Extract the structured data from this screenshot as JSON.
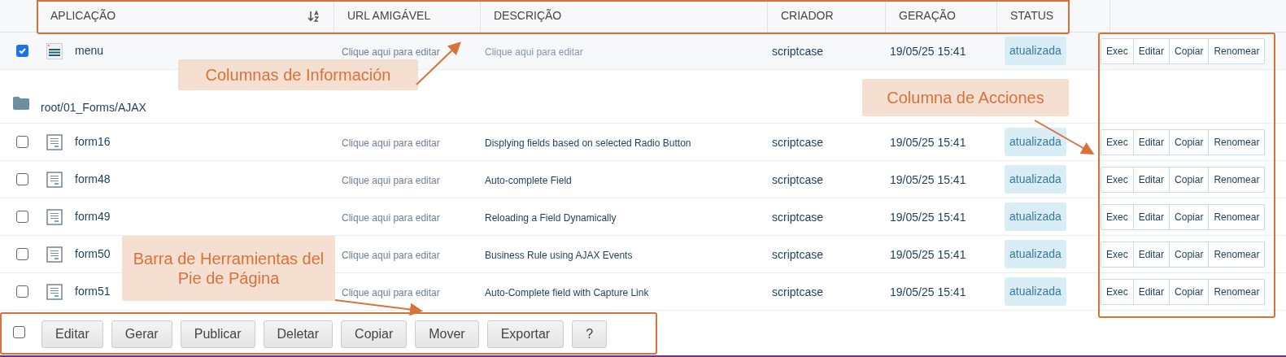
{
  "table": {
    "columns": [
      {
        "label": "APLICAÇÃO",
        "sorted": true
      },
      {
        "label": "URL AMIGÁVEL",
        "sorted": false
      },
      {
        "label": "DESCRIÇÃO",
        "sorted": false
      },
      {
        "label": "CRIADOR",
        "sorted": false
      },
      {
        "label": "GERAÇÃO",
        "sorted": false
      },
      {
        "label": "STATUS",
        "sorted": false
      }
    ],
    "rows": [
      {
        "kind": "menu",
        "checked": true,
        "name": "menu",
        "url": "Clique aqui para editar",
        "description": "Clique aqui para editar",
        "description_placeholder": true,
        "creator": "scriptcase",
        "generated": "19/05/25 15:41",
        "status": "atualizada",
        "actions": [
          "Exec",
          "Editar",
          "Copiar",
          "Renomear"
        ]
      },
      {
        "kind": "folder",
        "path": "root/01_Forms/AJAX"
      },
      {
        "kind": "form",
        "checked": false,
        "name": "form16",
        "url": "Clique aqui para editar",
        "description": "Displying fields based on selected Radio Button",
        "description_placeholder": false,
        "creator": "scriptcase",
        "generated": "19/05/25 15:41",
        "status": "atualizada",
        "actions": [
          "Exec",
          "Editar",
          "Copiar",
          "Renomear"
        ]
      },
      {
        "kind": "form",
        "checked": false,
        "name": "form48",
        "url": "Clique aqui para editar",
        "description": "Auto-complete Field",
        "description_placeholder": false,
        "creator": "scriptcase",
        "generated": "19/05/25 15:41",
        "status": "atualizada",
        "actions": [
          "Exec",
          "Editar",
          "Copiar",
          "Renomear"
        ]
      },
      {
        "kind": "form",
        "checked": false,
        "name": "form49",
        "url": "Clique aqui para editar",
        "description": "Reloading a Field Dynamically",
        "description_placeholder": false,
        "creator": "scriptcase",
        "generated": "19/05/25 15:41",
        "status": "atualizada",
        "actions": [
          "Exec",
          "Editar",
          "Copiar",
          "Renomear"
        ]
      },
      {
        "kind": "form",
        "checked": false,
        "name": "form50",
        "url": "Clique aqui para editar",
        "description": "Business Rule using AJAX Events",
        "description_placeholder": false,
        "creator": "scriptcase",
        "generated": "19/05/25 15:41",
        "status": "atualizada",
        "actions": [
          "Exec",
          "Editar",
          "Copiar",
          "Renomear"
        ]
      },
      {
        "kind": "form",
        "checked": false,
        "name": "form51",
        "url": "Clique aqui para editar",
        "description": "Auto-Complete field with Capture Link",
        "description_placeholder": false,
        "creator": "scriptcase",
        "generated": "19/05/25 15:41",
        "status": "atualizada",
        "actions": [
          "Exec",
          "Editar",
          "Copiar",
          "Renomear"
        ]
      }
    ]
  },
  "footer_toolbar": {
    "select_all_checked": false,
    "buttons": [
      "Editar",
      "Gerar",
      "Publicar",
      "Deletar",
      "Copiar",
      "Mover",
      "Exportar",
      "?"
    ]
  },
  "annotations": [
    {
      "kind": "columns",
      "text": "Columnas de Información"
    },
    {
      "kind": "actions",
      "text": "Columna de Acciones"
    },
    {
      "kind": "footer",
      "text": "Barra de Herramientas del Pie de Página"
    }
  ]
}
